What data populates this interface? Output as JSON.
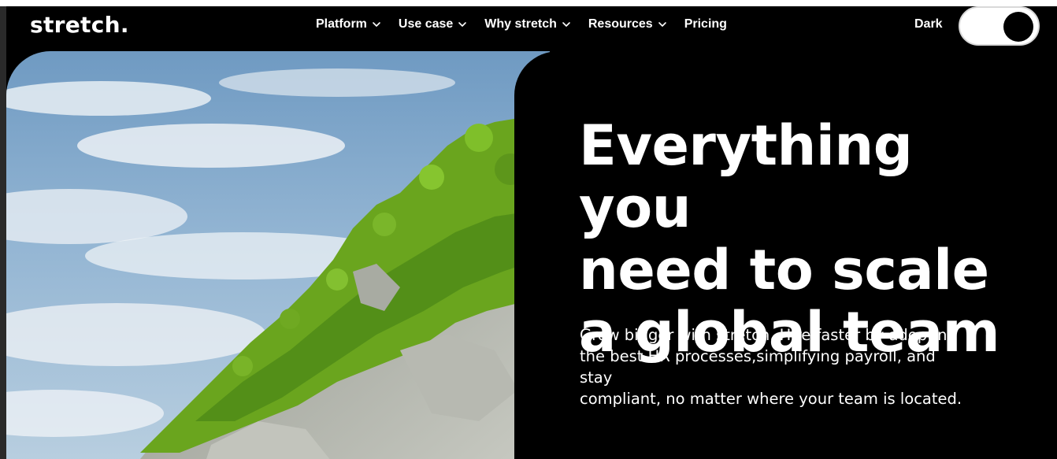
{
  "brand": {
    "logo_text": "stretch."
  },
  "nav": {
    "items": [
      {
        "label": "Platform",
        "has_dropdown": true
      },
      {
        "label": "Use case",
        "has_dropdown": true
      },
      {
        "label": "Why stretch",
        "has_dropdown": true
      },
      {
        "label": "Resources",
        "has_dropdown": true
      },
      {
        "label": "Pricing",
        "has_dropdown": false
      }
    ],
    "theme_label": "Dark",
    "theme_toggle_on": true
  },
  "hero": {
    "headline_lines": [
      "Everything you",
      "need to scale",
      "a global team"
    ],
    "subtext_lines": [
      "Grow bigger with stretch. Hire faster by adopting",
      "the best HR processes,simplifying payroll, and stay",
      "compliant, no matter where your team is located."
    ],
    "image_subject": "green forested cliff against blue cloudy sky"
  },
  "colors": {
    "background": "#000000",
    "text": "#ffffff",
    "foliage": "#6aa51e",
    "sky": "#7fa6c8"
  }
}
